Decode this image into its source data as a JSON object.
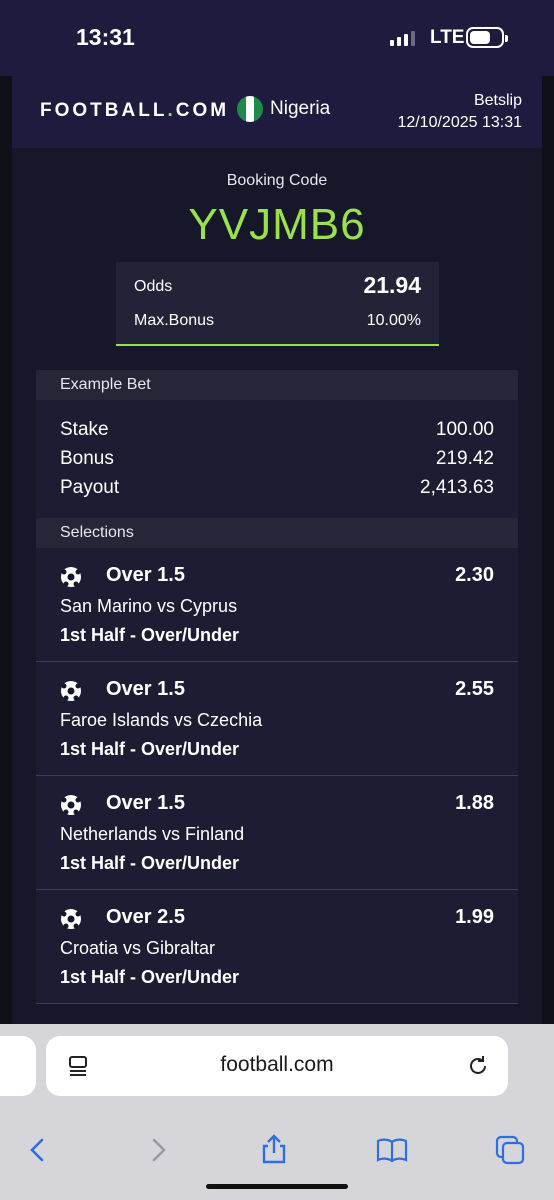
{
  "status_bar": {
    "time": "13:31",
    "network": "LTE"
  },
  "header": {
    "logo_text": "FOOTBALL",
    "logo_dot": ".",
    "logo_suffix": "COM",
    "country": "Nigeria",
    "betslip_label": "Betslip",
    "datetime": "12/10/2025 13:31"
  },
  "booking": {
    "label": "Booking Code",
    "code": "YVJMB6",
    "odds_label": "Odds",
    "odds_value": "21.94",
    "max_bonus_label": "Max.Bonus",
    "max_bonus_value": "10.00%"
  },
  "example_bet": {
    "title": "Example Bet",
    "rows": [
      {
        "label": "Stake",
        "value": "100.00"
      },
      {
        "label": "Bonus",
        "value": "219.42"
      },
      {
        "label": "Payout",
        "value": "2,413.63"
      }
    ]
  },
  "selections": {
    "title": "Selections",
    "items": [
      {
        "pick": "Over 1.5",
        "odds": "2.30",
        "match": "San Marino vs Cyprus",
        "market": "1st Half - Over/Under"
      },
      {
        "pick": "Over 1.5",
        "odds": "2.55",
        "match": "Faroe Islands vs Czechia",
        "market": "1st Half - Over/Under"
      },
      {
        "pick": "Over 1.5",
        "odds": "1.88",
        "match": "Netherlands vs Finland",
        "market": "1st Half - Over/Under"
      },
      {
        "pick": "Over 2.5",
        "odds": "1.99",
        "match": "Croatia vs Gibraltar",
        "market": "1st Half - Over/Under"
      }
    ]
  },
  "browser": {
    "url": "football.com",
    "icons": [
      "reader-icon",
      "reload-icon",
      "back-icon",
      "forward-icon",
      "share-icon",
      "bookmarks-icon",
      "tabs-icon"
    ]
  },
  "colors": {
    "accent": "#9ae14b",
    "header_bg": "#1e1b3f",
    "page_bg": "#17172a"
  }
}
